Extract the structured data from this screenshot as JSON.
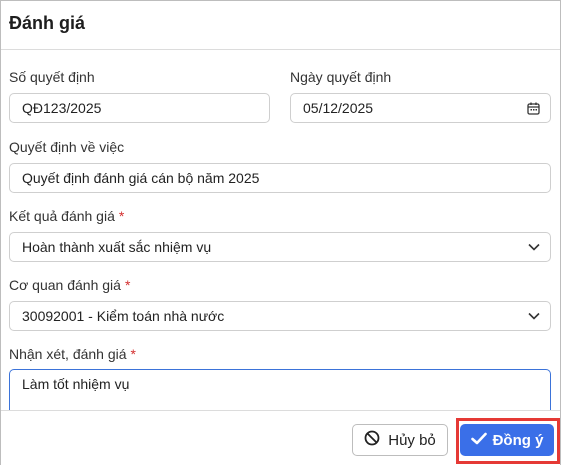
{
  "dialog": {
    "title": "Đánh giá"
  },
  "form": {
    "decision_number": {
      "label": "Số quyết định",
      "value": "QĐ123/2025"
    },
    "decision_date": {
      "label": "Ngày quyết định",
      "value": "05/12/2025"
    },
    "decision_subject": {
      "label": "Quyết định về việc",
      "value": "Quyết định đánh giá cán bộ năm 2025"
    },
    "result": {
      "label": "Kết quả đánh giá",
      "required_mark": "*",
      "value": "Hoàn thành xuất sắc nhiệm vụ"
    },
    "agency": {
      "label": "Cơ quan đánh giá",
      "required_mark": "*",
      "value": "30092001 - Kiểm toán nhà nước"
    },
    "comment": {
      "label": "Nhận xét, đánh giá",
      "required_mark": "*",
      "value": "Làm tốt nhiệm vụ"
    }
  },
  "footer": {
    "cancel_label": "Hủy bỏ",
    "ok_label": "Đồng ý"
  },
  "colors": {
    "primary": "#3a6fe8",
    "required": "#d32f2f",
    "highlight": "#e53935"
  },
  "icons": [
    "calendar-icon",
    "chevron-down-icon",
    "cancel-icon",
    "check-icon"
  ]
}
